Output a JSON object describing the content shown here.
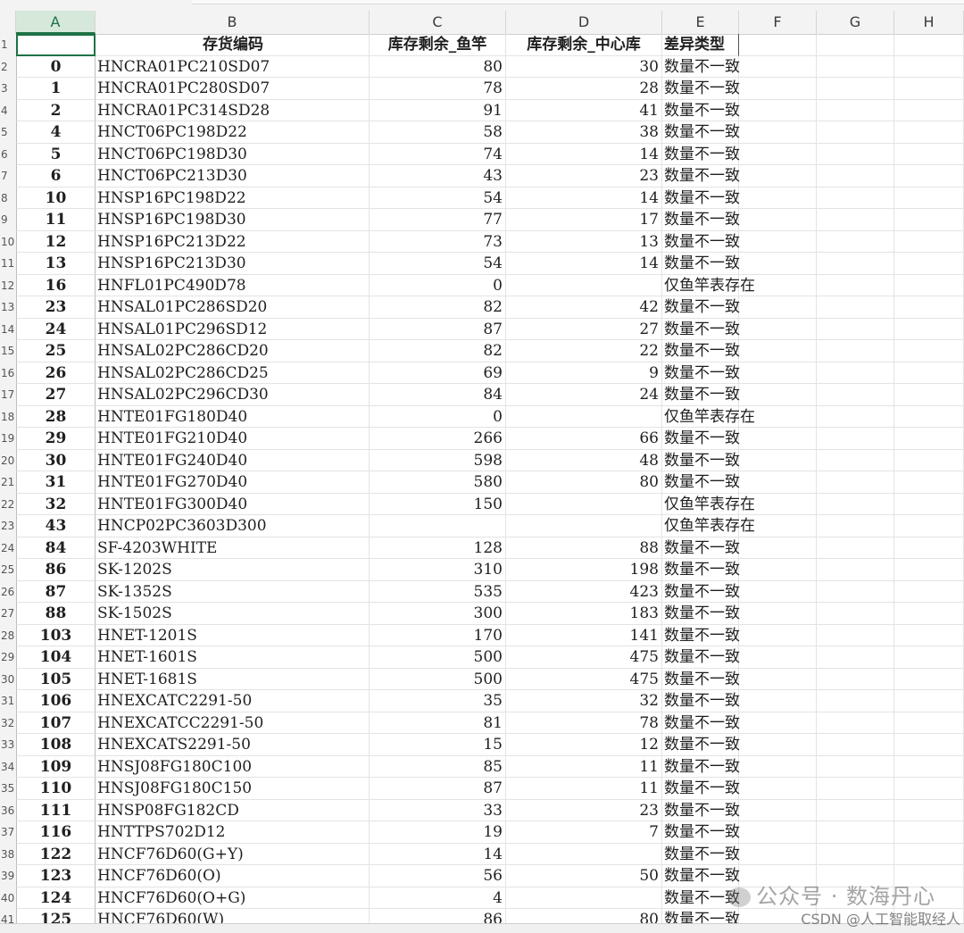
{
  "columns": [
    "A",
    "B",
    "C",
    "D",
    "E",
    "F",
    "G",
    "H"
  ],
  "row_numbers": [
    "1",
    "2",
    "3",
    "4",
    "5",
    "6",
    "7",
    "8",
    "9",
    "10",
    "11",
    "12",
    "13",
    "14",
    "15",
    "16",
    "17",
    "18",
    "19",
    "20",
    "21",
    "22",
    "23",
    "24",
    "25",
    "26",
    "27",
    "28",
    "29",
    "30",
    "31",
    "32",
    "33",
    "34",
    "35",
    "36",
    "37",
    "38",
    "39",
    "40",
    "41"
  ],
  "header": {
    "A": "",
    "B": "存货编码",
    "C": "库存剩余_鱼竿",
    "D": "库存剩余_中心库",
    "E": "差异类型"
  },
  "rows": [
    {
      "A": "0",
      "B": "HNCRA01PC210SD07",
      "C": "80",
      "D": "30",
      "E": "数量不一致"
    },
    {
      "A": "1",
      "B": "HNCRA01PC280SD07",
      "C": "78",
      "D": "28",
      "E": "数量不一致"
    },
    {
      "A": "2",
      "B": "HNCRA01PC314SD28",
      "C": "91",
      "D": "41",
      "E": "数量不一致"
    },
    {
      "A": "4",
      "B": "HNCT06PC198D22",
      "C": "58",
      "D": "38",
      "E": "数量不一致"
    },
    {
      "A": "5",
      "B": "HNCT06PC198D30",
      "C": "74",
      "D": "14",
      "E": "数量不一致"
    },
    {
      "A": "6",
      "B": "HNCT06PC213D30",
      "C": "43",
      "D": "23",
      "E": "数量不一致"
    },
    {
      "A": "10",
      "B": "HNSP16PC198D22",
      "C": "54",
      "D": "14",
      "E": "数量不一致"
    },
    {
      "A": "11",
      "B": "HNSP16PC198D30",
      "C": "77",
      "D": "17",
      "E": "数量不一致"
    },
    {
      "A": "12",
      "B": "HNSP16PC213D22",
      "C": "73",
      "D": "13",
      "E": "数量不一致"
    },
    {
      "A": "13",
      "B": "HNSP16PC213D30",
      "C": "54",
      "D": "14",
      "E": "数量不一致"
    },
    {
      "A": "16",
      "B": "HNFL01PC490D78",
      "C": "0",
      "D": "",
      "E": "仅鱼竿表存在"
    },
    {
      "A": "23",
      "B": "HNSAL01PC286SD20",
      "C": "82",
      "D": "42",
      "E": "数量不一致"
    },
    {
      "A": "24",
      "B": "HNSAL01PC296SD12",
      "C": "87",
      "D": "27",
      "E": "数量不一致"
    },
    {
      "A": "25",
      "B": "HNSAL02PC286CD20",
      "C": "82",
      "D": "22",
      "E": "数量不一致"
    },
    {
      "A": "26",
      "B": "HNSAL02PC286CD25",
      "C": "69",
      "D": "9",
      "E": "数量不一致"
    },
    {
      "A": "27",
      "B": "HNSAL02PC296CD30",
      "C": "84",
      "D": "24",
      "E": "数量不一致"
    },
    {
      "A": "28",
      "B": "HNTE01FG180D40",
      "C": "0",
      "D": "",
      "E": "仅鱼竿表存在"
    },
    {
      "A": "29",
      "B": "HNTE01FG210D40",
      "C": "266",
      "D": "66",
      "E": "数量不一致"
    },
    {
      "A": "30",
      "B": "HNTE01FG240D40",
      "C": "598",
      "D": "48",
      "E": "数量不一致"
    },
    {
      "A": "31",
      "B": "HNTE01FG270D40",
      "C": "580",
      "D": "80",
      "E": "数量不一致"
    },
    {
      "A": "32",
      "B": "HNTE01FG300D40",
      "C": "150",
      "D": "",
      "E": "仅鱼竿表存在"
    },
    {
      "A": "43",
      "B": "HNCP02PC3603D300",
      "C": "",
      "D": "",
      "E": "仅鱼竿表存在"
    },
    {
      "A": "84",
      "B": "SF-4203WHITE",
      "C": "128",
      "D": "88",
      "E": "数量不一致"
    },
    {
      "A": "86",
      "B": "SK-1202S",
      "C": "310",
      "D": "198",
      "E": "数量不一致"
    },
    {
      "A": "87",
      "B": "SK-1352S",
      "C": "535",
      "D": "423",
      "E": "数量不一致"
    },
    {
      "A": "88",
      "B": "SK-1502S",
      "C": "300",
      "D": "183",
      "E": "数量不一致"
    },
    {
      "A": "103",
      "B": "HNET-1201S",
      "C": "170",
      "D": "141",
      "E": "数量不一致"
    },
    {
      "A": "104",
      "B": "HNET-1601S",
      "C": "500",
      "D": "475",
      "E": "数量不一致"
    },
    {
      "A": "105",
      "B": "HNET-1681S",
      "C": "500",
      "D": "475",
      "E": "数量不一致"
    },
    {
      "A": "106",
      "B": "HNEXCATC2291-50",
      "C": "35",
      "D": "32",
      "E": "数量不一致"
    },
    {
      "A": "107",
      "B": "HNEXCATCC2291-50",
      "C": "81",
      "D": "78",
      "E": "数量不一致"
    },
    {
      "A": "108",
      "B": "HNEXCATS2291-50",
      "C": "15",
      "D": "12",
      "E": "数量不一致"
    },
    {
      "A": "109",
      "B": "HNSJ08FG180C100",
      "C": "85",
      "D": "11",
      "E": "数量不一致"
    },
    {
      "A": "110",
      "B": "HNSJ08FG180C150",
      "C": "87",
      "D": "11",
      "E": "数量不一致"
    },
    {
      "A": "111",
      "B": "HNSP08FG182CD",
      "C": "33",
      "D": "23",
      "E": "数量不一致"
    },
    {
      "A": "116",
      "B": "HNTTPS702D12",
      "C": "19",
      "D": "7",
      "E": "数量不一致"
    },
    {
      "A": "122",
      "B": "HNCF76D60(G+Y)",
      "C": "14",
      "D": "",
      "E": "数量不一致"
    },
    {
      "A": "123",
      "B": "HNCF76D60(O)",
      "C": "56",
      "D": "50",
      "E": "数量不一致"
    },
    {
      "A": "124",
      "B": "HNCF76D60(O+G)",
      "C": "4",
      "D": "",
      "E": "数量不一致"
    },
    {
      "A": "125",
      "B": "HNCF76D60(W)",
      "C": "86",
      "D": "80",
      "E": "数量不一致"
    }
  ],
  "watermark": {
    "main": "公众号 · 数海丹心",
    "sub": "CSDN @人工智能取经人"
  },
  "colors": {
    "selected_col": "#1e7145",
    "header_bg": "#f3f3f3",
    "grid_line": "#e3e3e3"
  }
}
